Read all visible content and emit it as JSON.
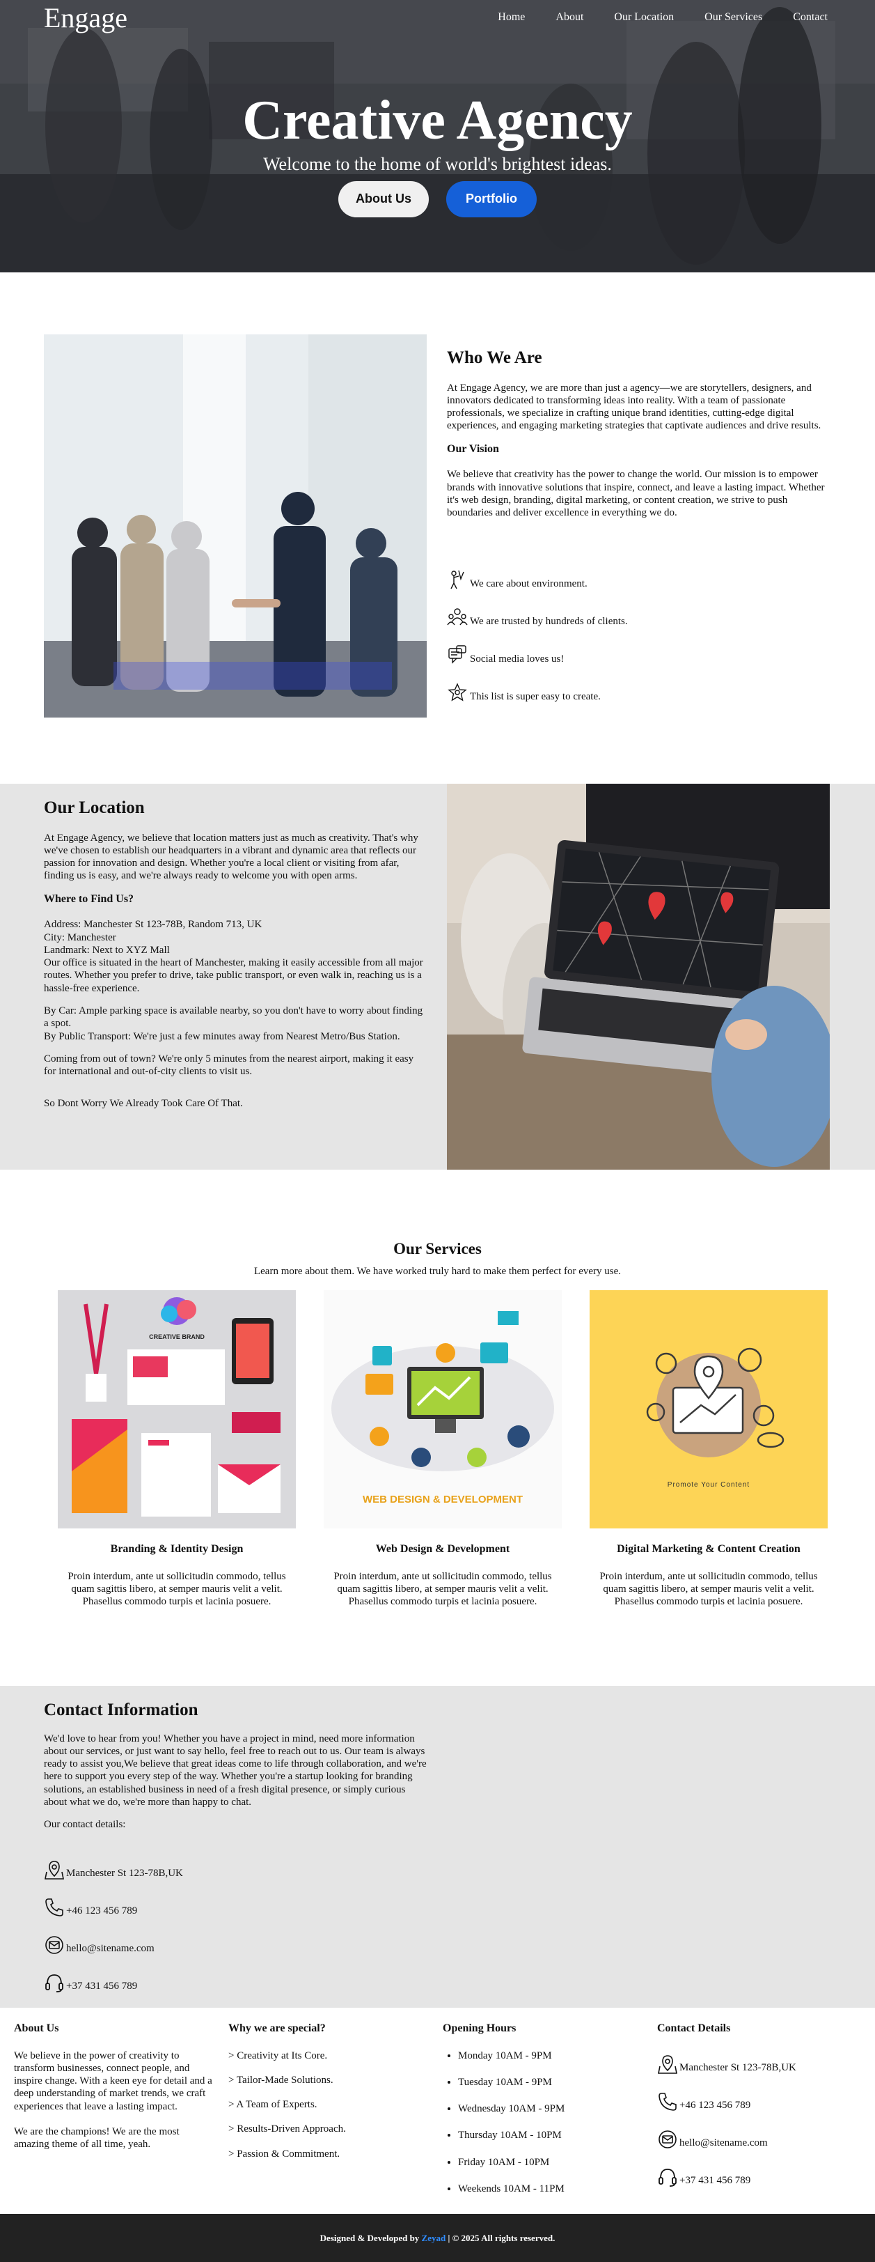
{
  "nav": {
    "brand": "Engage",
    "links": [
      "Home",
      "About",
      "Our Location",
      "Our Services",
      "Contact"
    ]
  },
  "hero": {
    "title": "Creative Agency",
    "subtitle": "Welcome to the home of world's brightest ideas.",
    "about_btn": "About Us",
    "portfolio_btn": "Portfolio"
  },
  "who": {
    "title": "Who We Are",
    "intro": "At Engage Agency, we are more than just a agency—we are storytellers, designers, and innovators dedicated to transforming ideas into reality. With a team of passionate professionals, we specialize in crafting unique brand identities, cutting-edge digital experiences, and engaging marketing strategies that captivate audiences and drive results.",
    "vision_title": "Our Vision",
    "vision": "We believe that creativity has the power to change the world. Our mission is to empower brands with innovative solutions that inspire, connect, and leave a lasting impact. Whether it's web design, branding, digital marketing, or content creation, we strive to push boundaries and deliver excellence in everything we do.",
    "features": [
      {
        "icon": "environment-icon",
        "text": "We care about environment."
      },
      {
        "icon": "people-icon",
        "text": "We are trusted by hundreds of clients."
      },
      {
        "icon": "social-media-icon",
        "text": "Social media loves us!"
      },
      {
        "icon": "star-icon",
        "text": "This list is super easy to create."
      }
    ]
  },
  "location": {
    "title": "Our Location",
    "intro": "At Engage Agency, we believe that location matters just as much as creativity. That's why we've chosen to establish our headquarters in a vibrant and dynamic area that reflects our passion for innovation and design. Whether you're a local client or visiting from afar, finding us is easy, and we're always ready to welcome you with open arms.",
    "where_title": "Where to Find Us?",
    "address": "Address: Manchester St 123-78B, Random 713, UK",
    "city": "City: Manchester",
    "landmark": "Landmark: Next to XYZ Mall",
    "office": "Our office is situated in the heart of Manchester, making it easily accessible from all major routes. Whether you prefer to drive, take public transport, or even walk in, reaching us is a hassle-free experience.",
    "by_car": "By Car: Ample parking space is available nearby, so you don't have to worry about finding a spot.",
    "by_public": "By Public Transport: We're just a few minutes away from Nearest Metro/Bus Station.",
    "out_of_town": "Coming from out of town? We're only 5 minutes from the nearest airport, making it easy for international and out-of-city clients to visit us.",
    "closing": "So Dont Worry We Already Took Care Of That."
  },
  "services": {
    "title": "Our Services",
    "subtitle": "Learn more about them. We have worked truly hard to make them perfect for every use.",
    "items": [
      {
        "title": "Branding & Identity Design",
        "desc": "Proin interdum, ante ut sollicitudin commodo, tellus quam sagittis libero, at semper mauris velit a velit. Phasellus commodo turpis et lacinia posuere."
      },
      {
        "title": "Web Design & Development",
        "desc": "Proin interdum, ante ut sollicitudin commodo, tellus quam sagittis libero, at semper mauris velit a velit. Phasellus commodo turpis et lacinia posuere."
      },
      {
        "title": "Digital Marketing & Content Creation",
        "desc": "Proin interdum, ante ut sollicitudin commodo, tellus quam sagittis libero, at semper mauris velit a velit. Phasellus commodo turpis et lacinia posuere."
      }
    ],
    "img_labels": {
      "branding": "CREATIVE BRAND",
      "web": "WEB DESIGN & DEVELOPMENT",
      "marketing": "Promote Your Content"
    }
  },
  "contact": {
    "title": "Contact Information",
    "intro": "We'd love to hear from you! Whether you have a project in mind, need more information about our services, or just want to say hello, feel free to reach out to us. Our team is always ready to assist you,We believe that great ideas come to life through collaboration, and we're here to support you every step of the way. Whether you're a startup looking for branding solutions, an established business in need of a fresh digital presence, or simply curious about what we do, we're more than happy to chat.",
    "details_label": "Our contact details:",
    "address": "Manchester St 123-78B,UK",
    "phone": "+46 123 456 789",
    "email": "hello@sitename.com",
    "support": "+37 431 456 789"
  },
  "footer": {
    "about_title": "About Us",
    "about_p1": "We believe in the power of creativity to transform businesses, connect people, and inspire change. With a keen eye for detail and a deep understanding of market trends, we craft experiences that leave a lasting impact.",
    "about_p2": "We are the champions! We are the most amazing theme of all time, yeah.",
    "special_title": "Why we are special?",
    "special": [
      "> Creativity at Its Core.",
      "> Tailor-Made Solutions.",
      "> A Team of Experts.",
      "> Results-Driven Approach.",
      "> Passion & Commitment."
    ],
    "hours_title": "Opening Hours",
    "hours": [
      "Monday 10AM - 9PM",
      "Tuesday 10AM - 9PM",
      "Wednesday 10AM - 9PM",
      "Thursday 10AM - 10PM",
      "Friday 10AM - 10PM",
      "Weekends 10AM - 11PM"
    ],
    "contact_title": "Contact Details",
    "address": "Manchester St 123-78B,UK",
    "phone": "+46 123 456 789",
    "email": "hello@sitename.com",
    "support": "+37 431 456 789",
    "credit_prefix": "Designed & Developed by",
    "credit_name": "Zeyad",
    "credit_suffix": "| © 2025 All rights reserved.",
    "accent": "#2f8cff"
  }
}
